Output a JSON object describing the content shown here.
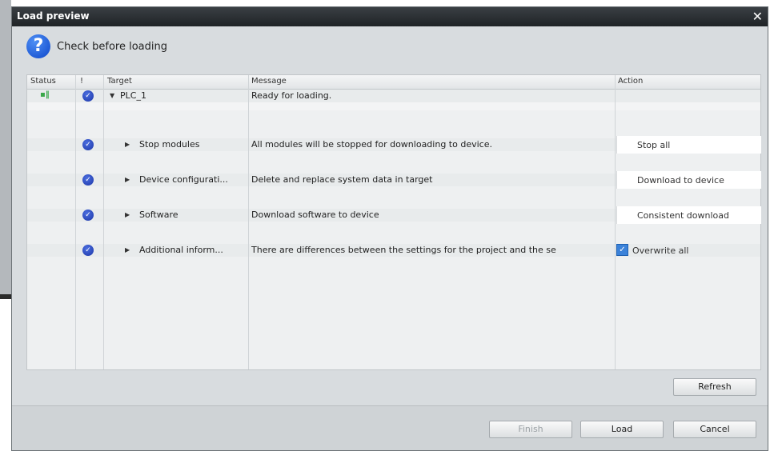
{
  "dialog": {
    "title": "Load preview",
    "close_glyph": "✕",
    "header_icon": "help-icon",
    "header_text": "Check before loading"
  },
  "table": {
    "columns": {
      "status": "Status",
      "info": "!",
      "target": "Target",
      "message": "Message",
      "action": "Action"
    },
    "rows": [
      {
        "target": "PLC_1",
        "message": "Ready for loading.",
        "action": ""
      },
      {
        "target": "Stop modules",
        "message": "All modules will be stopped for downloading to device.",
        "action": "Stop all"
      },
      {
        "target": "Device configurati...",
        "message": "Delete and replace system data in target",
        "action": "Download to device"
      },
      {
        "target": "Software",
        "message": "Download software to device",
        "action": "Consistent download"
      },
      {
        "target": "Additional inform...",
        "message": "There are differences between the settings for the project and the se",
        "action": "Overwrite all",
        "action_checked": true
      }
    ]
  },
  "buttons": {
    "refresh": "Refresh",
    "finish": "Finish",
    "load": "Load",
    "cancel": "Cancel"
  },
  "colors": {
    "titlebar": "#1f2326",
    "check_blue": "#1c36a8",
    "dialog_bg": "#d8dcdf"
  }
}
